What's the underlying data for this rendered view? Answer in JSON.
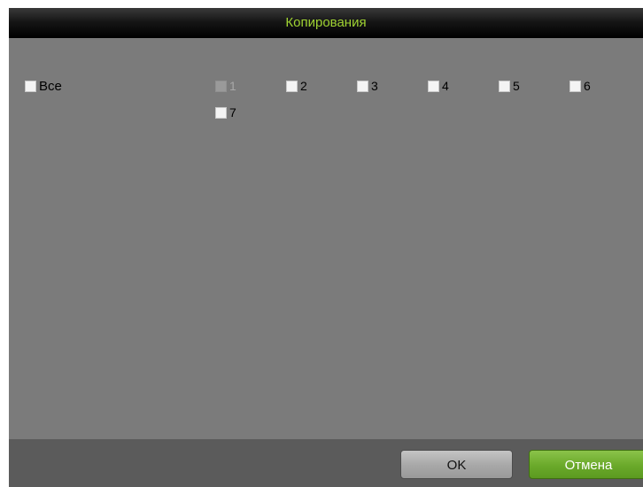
{
  "dialog": {
    "title": "Копирования"
  },
  "all_checkbox": {
    "label": "Все",
    "checked": false
  },
  "channels": [
    {
      "label": "1",
      "checked": false,
      "disabled": true
    },
    {
      "label": "2",
      "checked": false,
      "disabled": false
    },
    {
      "label": "3",
      "checked": false,
      "disabled": false
    },
    {
      "label": "4",
      "checked": false,
      "disabled": false
    },
    {
      "label": "5",
      "checked": false,
      "disabled": false
    },
    {
      "label": "6",
      "checked": false,
      "disabled": false
    },
    {
      "label": "7",
      "checked": false,
      "disabled": false
    }
  ],
  "buttons": {
    "ok_label": "OK",
    "cancel_label": "Отмена"
  },
  "colors": {
    "title_text": "#9fd232",
    "panel_bg": "#7b7b7b",
    "footer_bg": "#5b5b5b",
    "cancel_button": "#6aa92a"
  }
}
